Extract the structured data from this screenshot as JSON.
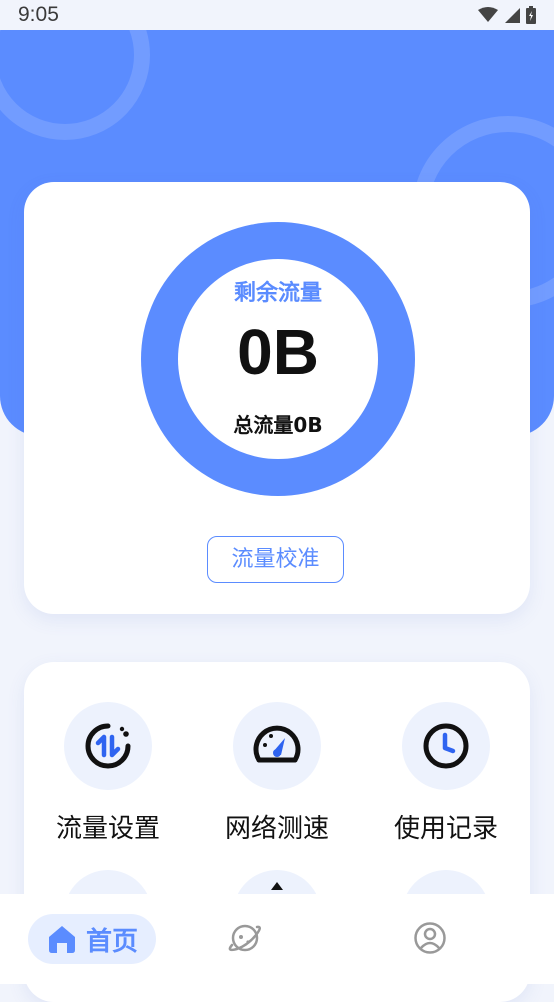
{
  "status": {
    "time": "9:05"
  },
  "traffic": {
    "remaining_label": "剩余流量",
    "remaining_value": "0B",
    "total_text": "总流量0B",
    "calibrate_button": "流量校准"
  },
  "tools": [
    {
      "label": "流量设置",
      "icon": "data-transfer-icon"
    },
    {
      "label": "网络测速",
      "icon": "speedometer-icon"
    },
    {
      "label": "使用记录",
      "icon": "clock-icon"
    }
  ],
  "nav": {
    "home_label": "首页",
    "items": [
      "home-icon",
      "planet-icon",
      "profile-icon"
    ]
  },
  "colors": {
    "accent": "#5b8cff",
    "background": "#f1f4fc",
    "icon_bg": "#edf2fd"
  }
}
